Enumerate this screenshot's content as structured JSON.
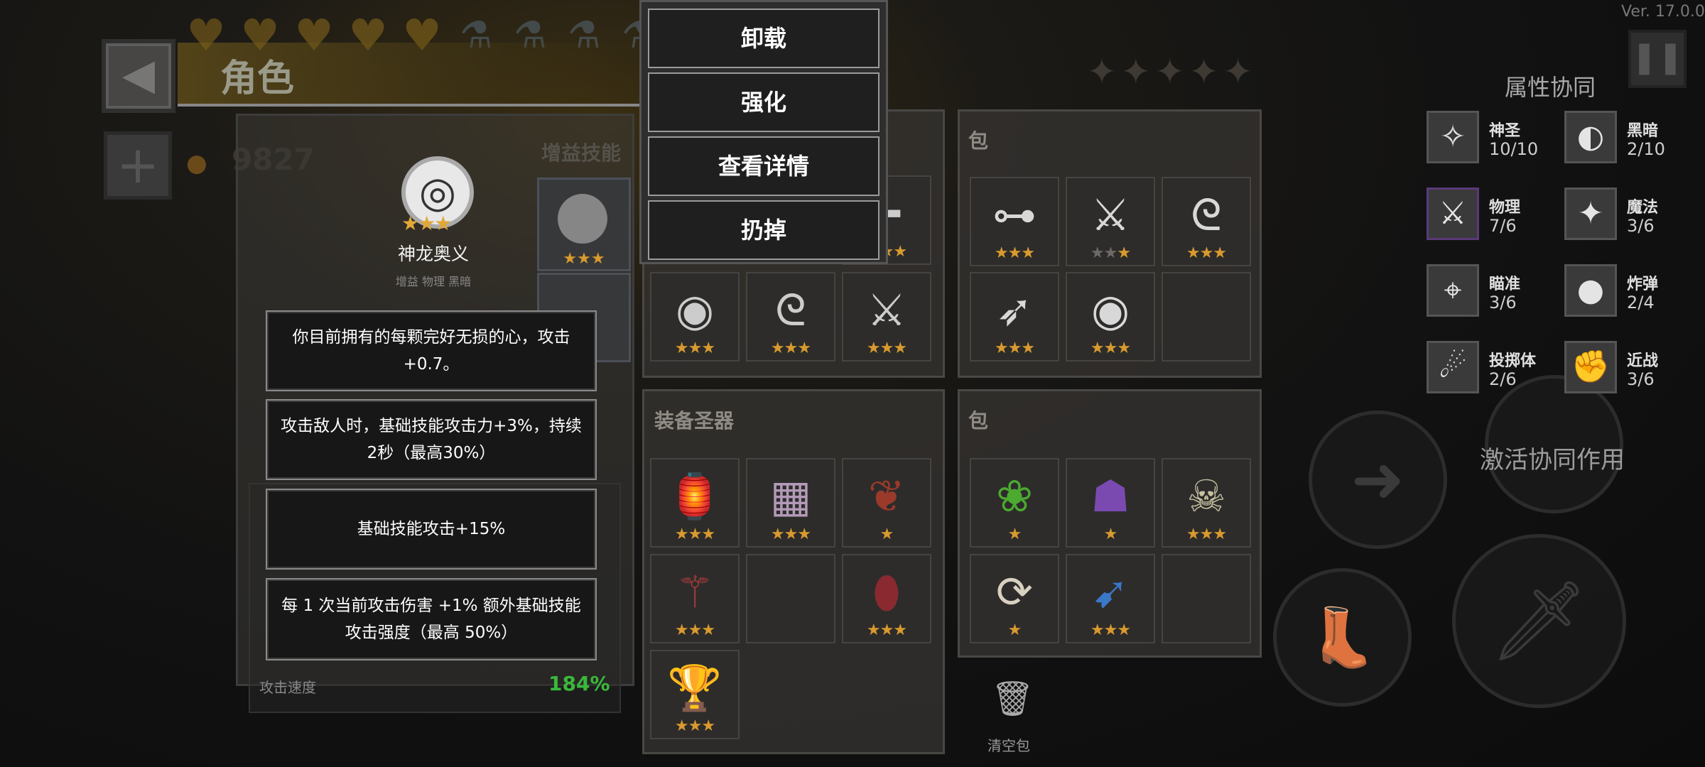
{
  "header": {
    "title": "角色",
    "coins": "9827"
  },
  "version": "Ver. 17.0.0",
  "skill_panel": {
    "buff_header": "增益技能",
    "selected_skill": {
      "name": "神龙奥义",
      "tags": "增益  物理  黑暗",
      "stars": "★★★"
    },
    "tooltips": [
      "你目前拥有的每颗完好无损的心，攻击+0.7。",
      "攻击敌人时，基础技能攻击力+3%，持续2秒（最高30%）",
      "基础技能攻击+15%",
      "每 1 次当前攻击伤害 +1% 额外基础技能攻击强度（最高 50%）"
    ],
    "stat": {
      "label": "攻击速度",
      "value": "184%"
    }
  },
  "context_menu": {
    "items": [
      "卸载",
      "强化",
      "查看详情",
      "扔掉"
    ]
  },
  "bag_panel_1": {
    "title": "包"
  },
  "relic_panel": {
    "title": "装备圣器"
  },
  "bag_panel_2": {
    "title": "包"
  },
  "trash": {
    "label": "清空包"
  },
  "synergy": {
    "title": "属性协同",
    "items": [
      {
        "name": "神圣",
        "value": "10/10",
        "icon": "holy-icon"
      },
      {
        "name": "黑暗",
        "value": "2/10",
        "icon": "dark-icon"
      },
      {
        "name": "物理",
        "value": "7/6",
        "icon": "sword-icon"
      },
      {
        "name": "魔法",
        "value": "3/6",
        "icon": "magic-icon"
      },
      {
        "name": "瞄准",
        "value": "3/6",
        "icon": "crosshair-icon"
      },
      {
        "name": "炸弹",
        "value": "2/4",
        "icon": "bomb-icon"
      },
      {
        "name": "投掷体",
        "value": "2/6",
        "icon": "projectile-icon"
      },
      {
        "name": "近战",
        "value": "3/6",
        "icon": "fist-icon"
      }
    ],
    "activate_label": "激活协同作用"
  }
}
